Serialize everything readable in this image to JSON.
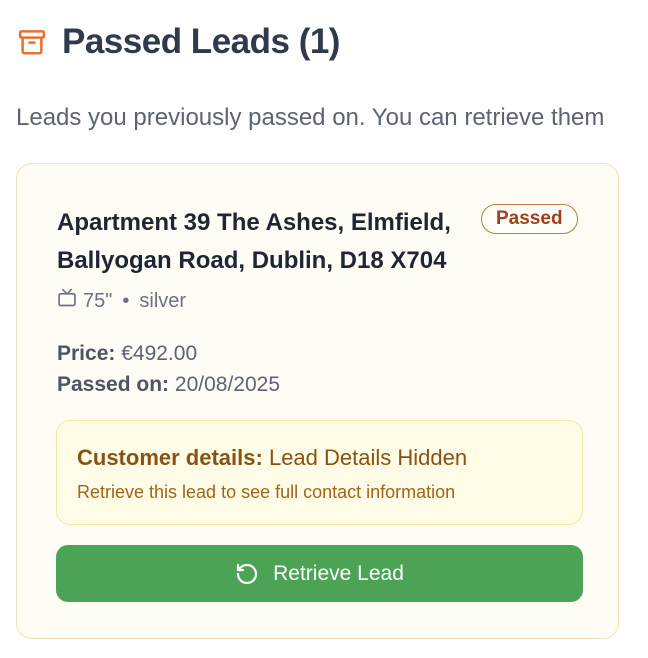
{
  "header": {
    "icon": "archive-icon",
    "title": "Passed Leads (1)",
    "accent_color": "#e0742f"
  },
  "subtitle": "Leads you previously passed on. You can retrieve them",
  "leads": [
    {
      "address": "Apartment 39 The Ashes, Elmfield, Ballyogan Road, Dublin, D18 X704",
      "status": "Passed",
      "specs": {
        "icon": "tv-icon",
        "size": "75\"",
        "separator": "•",
        "color": "silver"
      },
      "price_label": "Price:",
      "price": "€492.00",
      "passed_label": "Passed on:",
      "passed_date": "20/08/2025",
      "customer": {
        "label": "Customer details:",
        "value": "Lead Details Hidden",
        "note": "Retrieve this lead to see full contact information"
      },
      "button": {
        "icon": "refresh-icon",
        "label": "Retrieve Lead",
        "color": "#4ca356"
      }
    }
  ]
}
